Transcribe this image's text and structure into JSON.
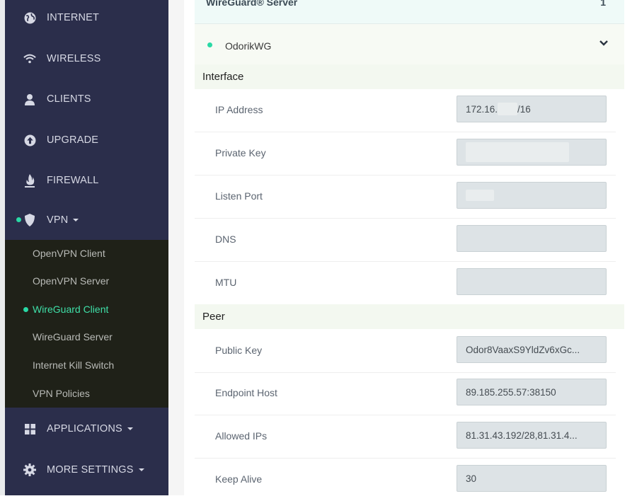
{
  "sidebar": {
    "items": [
      {
        "label": "INTERNET",
        "icon": "globe-icon"
      },
      {
        "label": "WIRELESS",
        "icon": "wifi-icon"
      },
      {
        "label": "CLIENTS",
        "icon": "user-icon"
      },
      {
        "label": "UPGRADE",
        "icon": "upgrade-icon"
      },
      {
        "label": "FIREWALL",
        "icon": "fire-icon"
      },
      {
        "label": "VPN",
        "icon": "shield-icon"
      },
      {
        "label": "APPLICATIONS",
        "icon": "grid-icon"
      },
      {
        "label": "MORE SETTINGS",
        "icon": "gear-icon"
      }
    ],
    "vpn_submenu": [
      {
        "label": "OpenVPN Client"
      },
      {
        "label": "OpenVPN Server"
      },
      {
        "label": "WireGuard Client",
        "active": true
      },
      {
        "label": "WireGuard Server"
      },
      {
        "label": "Internet Kill Switch"
      },
      {
        "label": "VPN Policies"
      }
    ]
  },
  "server_bar": {
    "title": "WireGuard® Server",
    "count": "1"
  },
  "connection": {
    "name": "OdorikWG",
    "status_color": "#29d9a5"
  },
  "interface": {
    "title": "Interface",
    "fields": [
      {
        "label": "IP Address",
        "value_prefix": "172.16.",
        "value_suffix": "/16"
      },
      {
        "label": "Private Key",
        "value": ""
      },
      {
        "label": "Listen Port",
        "value": ""
      },
      {
        "label": "DNS",
        "value": ""
      },
      {
        "label": "MTU",
        "value": ""
      }
    ]
  },
  "peer": {
    "title": "Peer",
    "fields": [
      {
        "label": "Public Key",
        "value": "Odor8VaaxS9YldZv6xGc..."
      },
      {
        "label": "Endpoint Host",
        "value": "89.185.255.57:38150"
      },
      {
        "label": "Allowed IPs",
        "value": "81.31.43.192/28,81.31.4..."
      },
      {
        "label": "Keep Alive",
        "value": "30"
      }
    ]
  },
  "colors": {
    "accent": "#29d9a5",
    "sidebar_bg": "#2b2e4b",
    "submenu_bg": "#1f2118"
  }
}
